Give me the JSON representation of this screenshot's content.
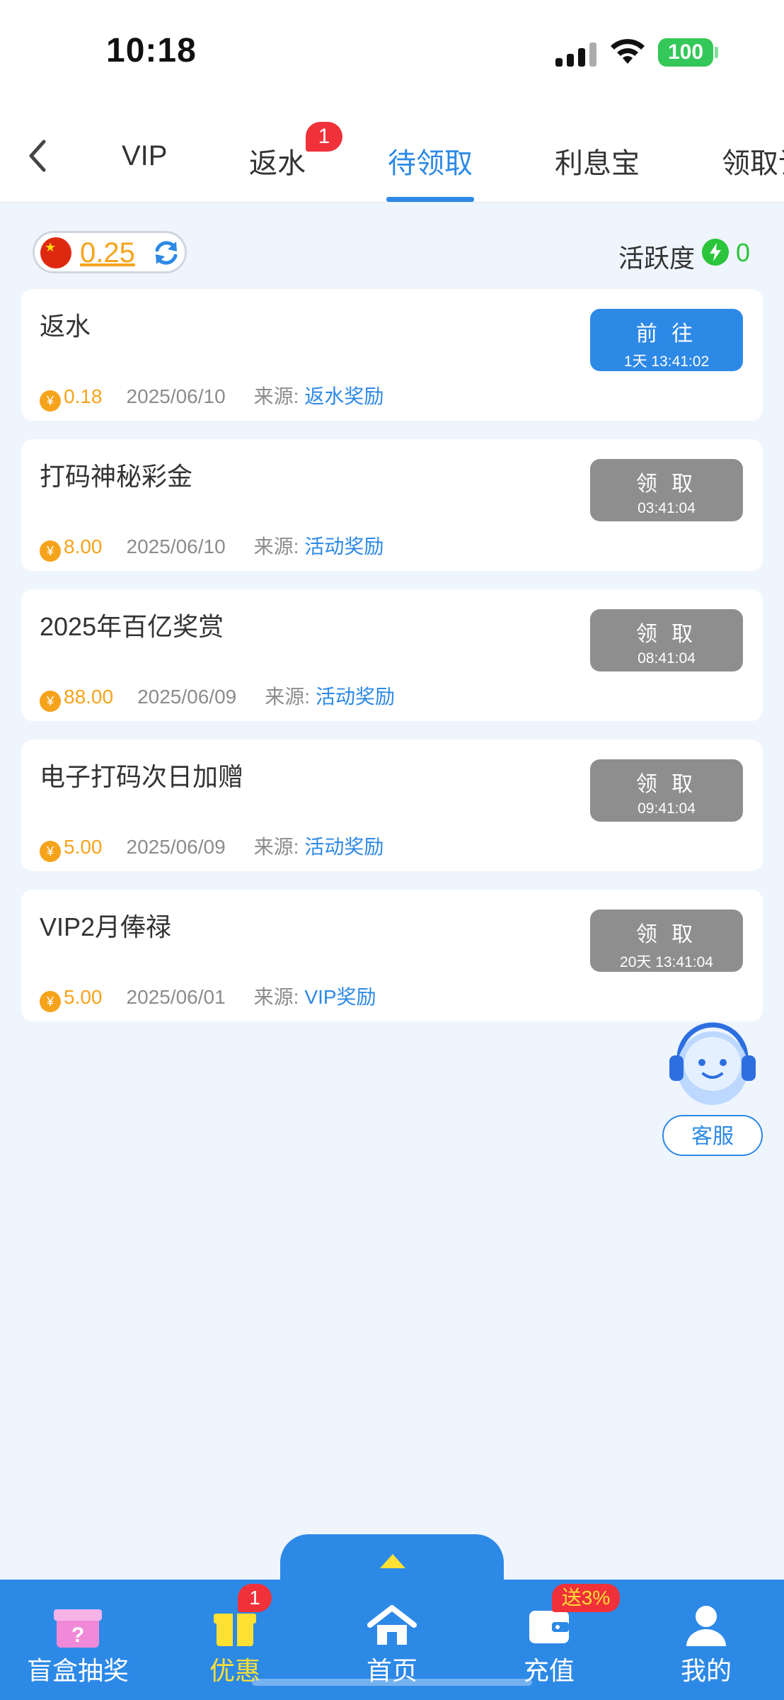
{
  "status_bar": {
    "time": "10:18",
    "battery": "100"
  },
  "tabs": [
    {
      "label": "VIP"
    },
    {
      "label": "返水",
      "badge": "1"
    },
    {
      "label": "待领取",
      "active": true
    },
    {
      "label": "利息宝"
    },
    {
      "label": "领取记录"
    }
  ],
  "balance": {
    "value": "0.25",
    "activity_label": "活跃度",
    "activity_value": "0"
  },
  "cards": [
    {
      "title": "返水",
      "amount": "0.18",
      "date": "2025/06/10",
      "source_label": "来源:",
      "source": "返水奖励",
      "button": "前 往",
      "timer": "1天 13:41:02",
      "enabled": true
    },
    {
      "title": "打码神秘彩金",
      "amount": "8.00",
      "date": "2025/06/10",
      "source_label": "来源:",
      "source": "活动奖励",
      "button": "领 取",
      "timer": "03:41:04",
      "enabled": false
    },
    {
      "title": "2025年百亿奖赏",
      "amount": "88.00",
      "date": "2025/06/09",
      "source_label": "来源:",
      "source": "活动奖励",
      "button": "领 取",
      "timer": "08:41:04",
      "enabled": false
    },
    {
      "title": "电子打码次日加赠",
      "amount": "5.00",
      "date": "2025/06/09",
      "source_label": "来源:",
      "source": "活动奖励",
      "button": "领 取",
      "timer": "09:41:04",
      "enabled": false
    },
    {
      "title": "VIP2月俸禄",
      "amount": "5.00",
      "date": "2025/06/01",
      "source_label": "来源:",
      "source": "VIP奖励",
      "button": "领 取",
      "timer": "20天 13:41:04",
      "enabled": false
    }
  ],
  "customer_service": {
    "label": "客服"
  },
  "bottom_nav": {
    "items": [
      {
        "label": "盲盒抽奖",
        "icon": "gift-box-icon"
      },
      {
        "label": "优惠",
        "icon": "gift-icon",
        "active": true,
        "badge": "1"
      },
      {
        "label": "首页",
        "icon": "home-icon"
      },
      {
        "label": "充值",
        "icon": "wallet-icon",
        "tag": "送3%"
      },
      {
        "label": "我的",
        "icon": "user-icon"
      }
    ]
  },
  "colors": {
    "accent": "#2d89e6",
    "coin": "#f6a31c",
    "disabled": "#8e8e8e",
    "active_nav": "#ffe033"
  }
}
